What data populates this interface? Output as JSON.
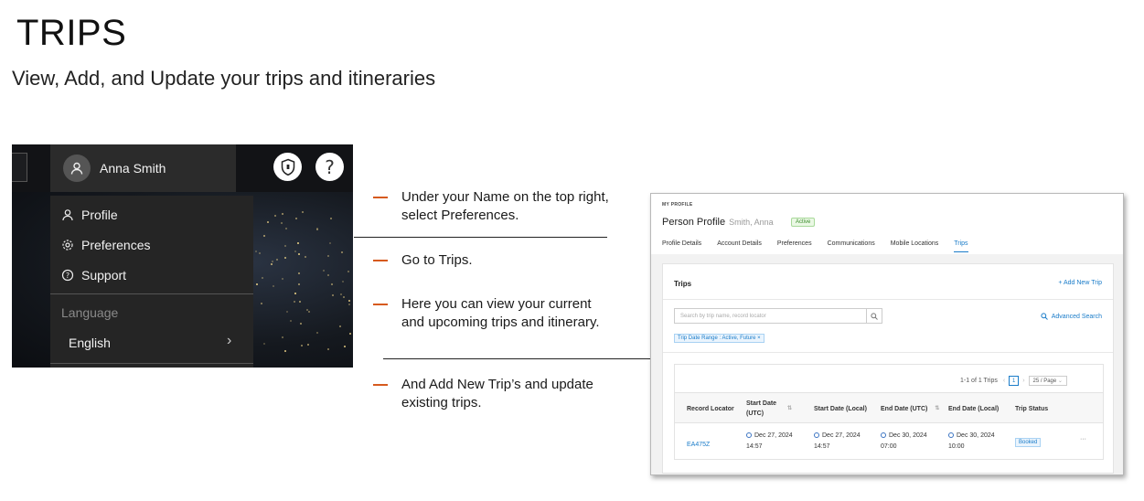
{
  "header": {
    "title": "TRIPS",
    "subtitle": "View, Add, and Update your trips and itineraries"
  },
  "menu_screenshot": {
    "user_name": "Anna Smith",
    "items": [
      "Profile",
      "Preferences",
      "Support"
    ],
    "language_label": "Language",
    "language_value": "English",
    "icons": [
      "user-icon",
      "shield-icon",
      "help-icon",
      "gear-icon"
    ]
  },
  "steps": [
    "Under your Name on the top right, select Preferences.",
    "Go to Trips.",
    "Here you can view your current and upcoming trips and itinerary.",
    "And Add New Trip’s and update existing trips."
  ],
  "profile_screenshot": {
    "section_label": "MY PROFILE",
    "title": "Person Profile",
    "person_name": "Smith, Anna",
    "status": "Active",
    "tabs": [
      "Profile Details",
      "Account Details",
      "Preferences",
      "Communications",
      "Mobile Locations",
      "Trips"
    ],
    "active_tab": "Trips",
    "card_title": "Trips",
    "add_trip": "+ Add New Trip",
    "search_placeholder": "Search by trip name, record locator",
    "advanced_search": "Advanced Search",
    "filter_chip": "Trip Date Range : Active, Future ×",
    "result_count": "1-1 of 1  Trips",
    "page": "1",
    "per_page": "25 / Page",
    "columns": [
      "Record Locator",
      "Start Date (UTC)",
      "Start Date (Local)",
      "End Date (UTC)",
      "End Date (Local)",
      "Trip Status"
    ],
    "rows": [
      {
        "record_locator": "EA475Z",
        "start_utc_date": "Dec 27, 2024",
        "start_utc_time": "14:57",
        "start_local_date": "Dec 27, 2024",
        "start_local_time": "14:57",
        "end_utc_date": "Dec 30, 2024",
        "end_utc_time": "07:00",
        "end_local_date": "Dec 30, 2024",
        "end_local_time": "10:00",
        "status": "Booked",
        "more": "···"
      }
    ],
    "colors": {
      "link": "#1a7cc9",
      "accent_dash": "#d65a1e"
    }
  }
}
